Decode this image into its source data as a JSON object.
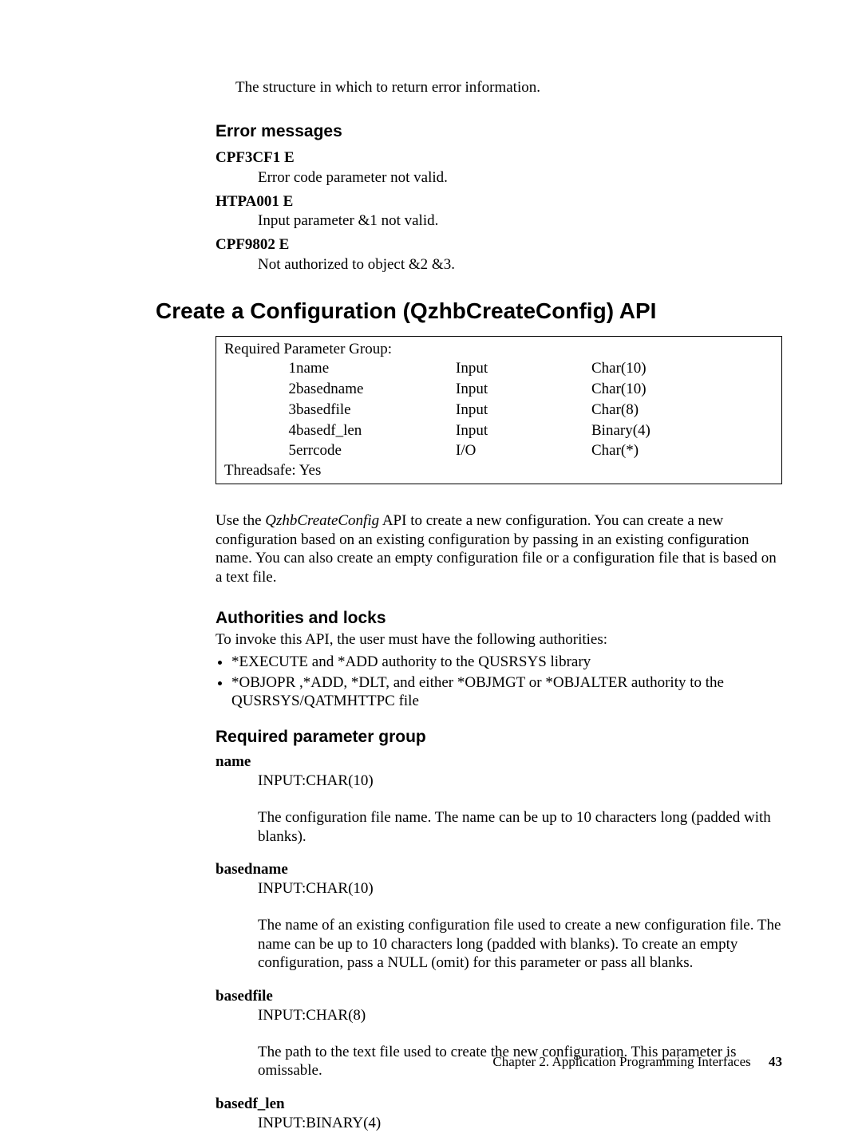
{
  "intro": "The structure in which to return error information.",
  "error_messages": {
    "heading": "Error messages",
    "items": [
      {
        "code": "CPF3CF1 E",
        "desc": "Error code parameter not valid."
      },
      {
        "code": "HTPA001 E",
        "desc": "Input parameter &1 not valid."
      },
      {
        "code": "CPF9802 E",
        "desc": "Not authorized to object &2 &3."
      }
    ]
  },
  "api_title": "Create a Configuration (QzhbCreateConfig) API",
  "param_box": {
    "header": "Required Parameter Group:",
    "rows": [
      {
        "n": "1",
        "name": "name",
        "io": "Input",
        "type": "Char(10)"
      },
      {
        "n": "2",
        "name": "basedname",
        "io": "Input",
        "type": "Char(10)"
      },
      {
        "n": "3",
        "name": "basedfile",
        "io": "Input",
        "type": "Char(8)"
      },
      {
        "n": "4",
        "name": "basedf_len",
        "io": "Input",
        "type": "Binary(4)"
      },
      {
        "n": "5",
        "name": "errcode",
        "io": "I/O",
        "type": "Char(*)"
      }
    ],
    "threadsafe": "Threadsafe: Yes"
  },
  "description": {
    "prefix": "Use the ",
    "api_name": "QzhbCreateConfig",
    "suffix": " API to create a new configuration. You can create a new configuration based on an existing configuration by passing in an existing configuration name. You can also create an empty configuration file or a configuration file that is based on a text file."
  },
  "authorities": {
    "heading": "Authorities and locks",
    "intro": "To invoke this API, the user must have the following authorities:",
    "items": [
      "*EXECUTE and *ADD authority to the QUSRSYS library",
      "*OBJOPR ,*ADD, *DLT, and either *OBJMGT or *OBJALTER authority to the QUSRSYS/QATMHTTPC file"
    ]
  },
  "required_params": {
    "heading": "Required parameter group",
    "items": [
      {
        "term": "name",
        "sig": "INPUT:CHAR(10)",
        "desc": "The configuration file name. The name can be up to 10 characters long (padded with blanks)."
      },
      {
        "term": "basedname",
        "sig": "INPUT:CHAR(10)",
        "desc": "The name of an existing configuration file used to create a new configuration file. The name can be up to 10 characters long (padded with blanks). To create an empty configuration, pass a NULL (omit) for this parameter or pass all blanks."
      },
      {
        "term": "basedfile",
        "sig": "INPUT:CHAR(8)",
        "desc": "The path to the text file used to create the new configuration. This parameter is omissable."
      },
      {
        "term": "basedf_len",
        "sig": "INPUT:BINARY(4)",
        "desc": ""
      }
    ]
  },
  "footer": {
    "chapter": "Chapter 2. Application Programming Interfaces",
    "page": "43"
  }
}
